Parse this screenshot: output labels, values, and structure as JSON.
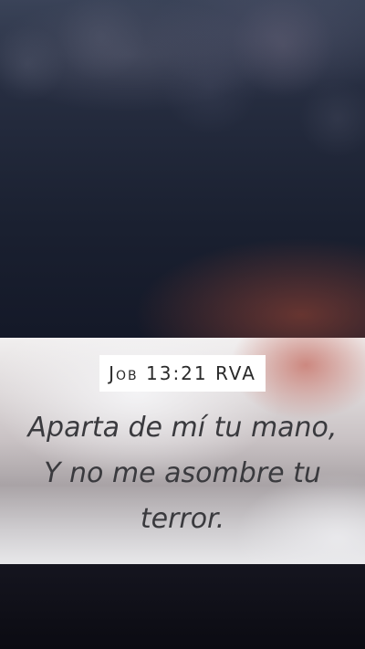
{
  "verse_card": {
    "reference": "Job 13:21 RVA",
    "verse": "Aparta de mí tu mano, Y no me asombre tu terror."
  }
}
